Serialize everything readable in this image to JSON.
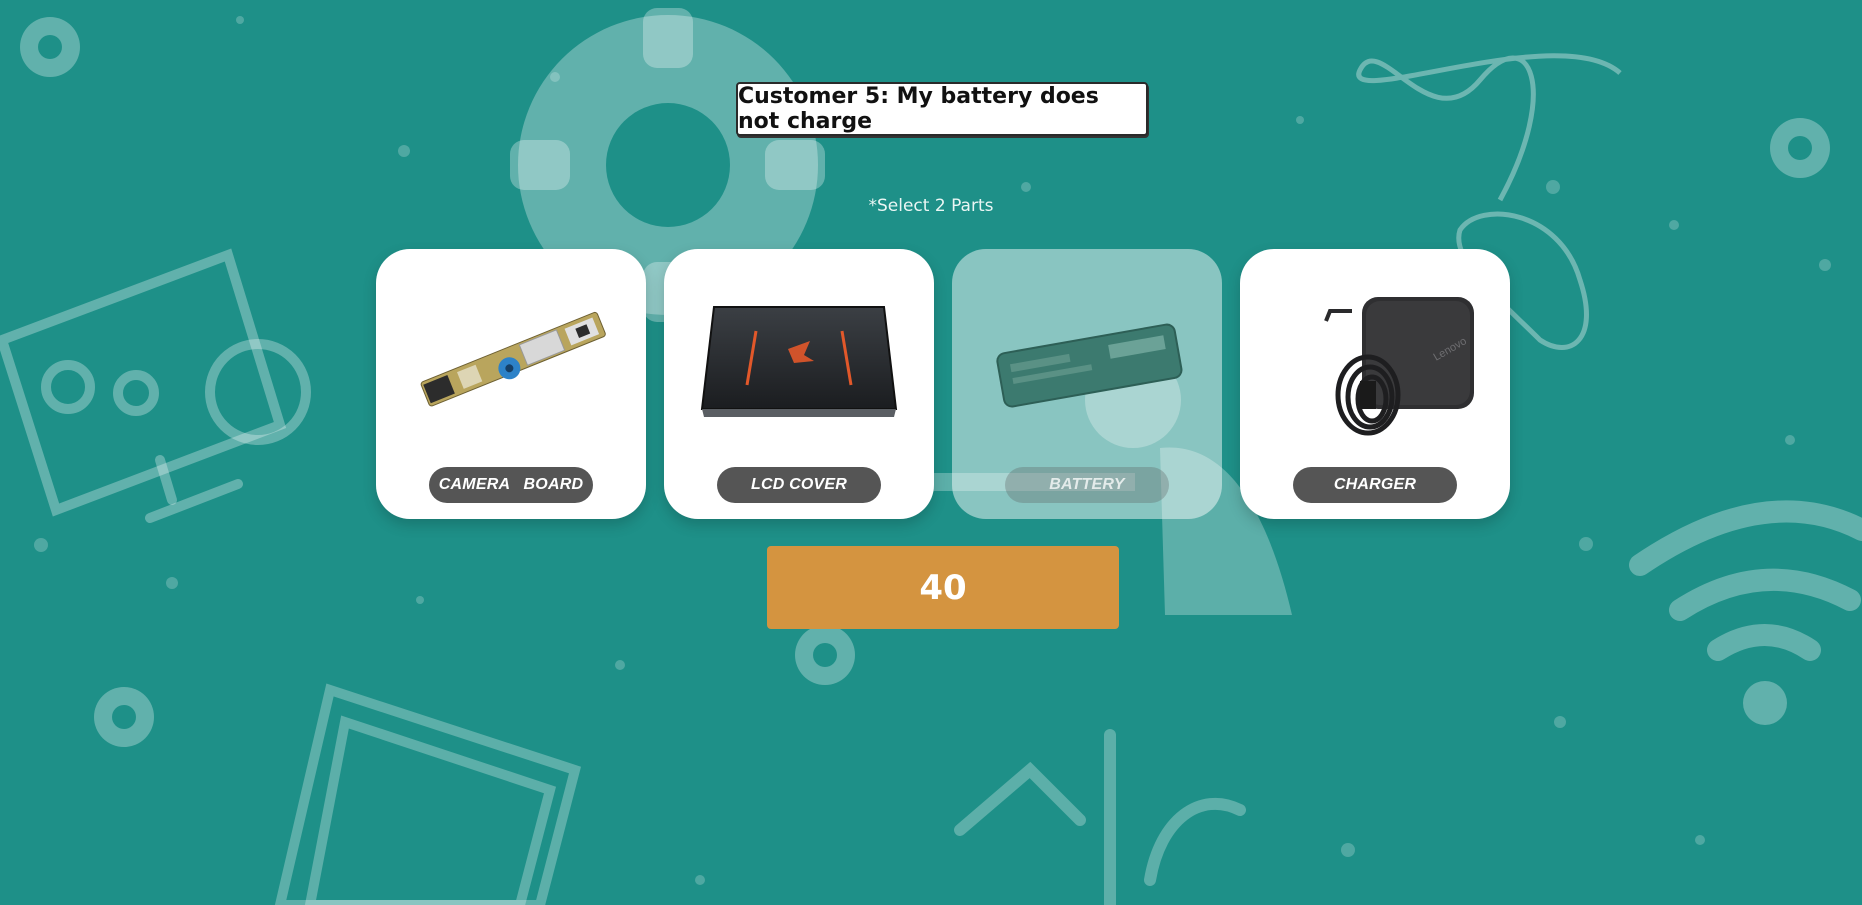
{
  "title": "Customer 5: My battery does not charge",
  "hint": "*Select 2 Parts",
  "parts": [
    {
      "label": "CAMERA   BOARD",
      "icon": "camera-board-image",
      "selected": false
    },
    {
      "label": "LCD COVER",
      "icon": "lcd-cover-image",
      "selected": false
    },
    {
      "label": "BATTERY",
      "icon": "battery-image",
      "selected": true
    },
    {
      "label": "CHARGER",
      "icon": "charger-image",
      "selected": false
    }
  ],
  "counter": "40",
  "charger_brand": "Lenovo",
  "colors": {
    "background": "#1e9088",
    "label_pill": "#555555",
    "counter": "#d49440",
    "card": "#ffffff"
  }
}
